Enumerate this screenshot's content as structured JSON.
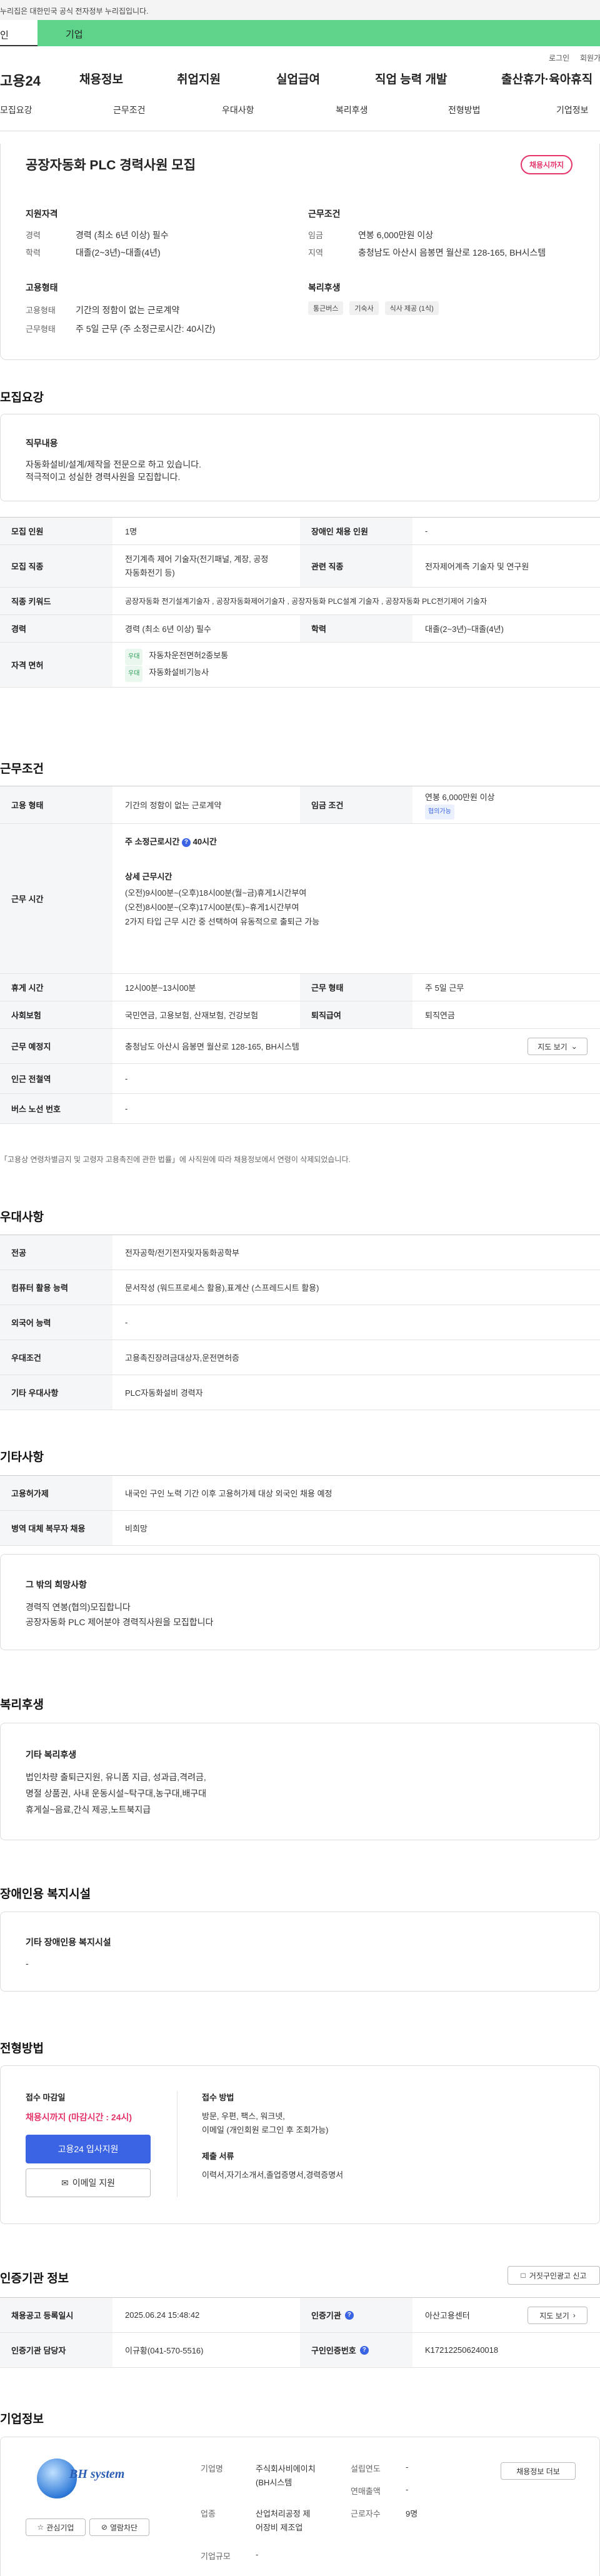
{
  "gov_bar": {
    "text": "누리집은 대한민국 공식 전자정부 누리집입니다."
  },
  "top_tabs": [
    "인",
    "기업"
  ],
  "util": {
    "login": "로그인",
    "join": "회원가"
  },
  "logo": "고용24",
  "gnb": [
    "채용정보",
    "취업지원",
    "실업급여",
    "직업 능력 개발",
    "출산휴가·육아휴직"
  ],
  "subnav": [
    "모집요강",
    "근무조건",
    "우대사항",
    "복리후생",
    "전형방법",
    "기업정보"
  ],
  "job": {
    "title": "공장자동화 PLC 경력사원 모집",
    "badge": "채용시까지",
    "qualification": {
      "head": "지원자격",
      "career_label": "경력",
      "career": "경력 (최소 6년 이상) 필수",
      "edu_label": "학력",
      "edu": "대졸(2~3년)~대졸(4년)"
    },
    "work": {
      "head": "근무조건",
      "pay_label": "임금",
      "pay": "연봉 6,000만원 이상",
      "region_label": "지역",
      "region": "충청남도 아산시 음봉면 월산로 128-165, BH시스템"
    },
    "employment": {
      "head": "고용형태",
      "type_label": "고용형태",
      "type": "기간의 정함이 없는 근로계약",
      "days_label": "근무형태",
      "days": "주 5일 근무 (주 소정근로시간: 40시간)"
    },
    "welfare": {
      "head": "복리후생",
      "chips": [
        "통근버스",
        "기숙사",
        "식사 제공 (1식)"
      ]
    }
  },
  "recruit": {
    "title": "모집요강",
    "duty_head": "직무내용",
    "duty_lines": [
      "자동화설비/설계/제작을 전문으로 하고 있습니다.",
      "적극적이고 성실한 경력사원을 모집합니다."
    ],
    "rows": {
      "headcount_label": "모집 인원",
      "headcount": "1명",
      "disabled_label": "장애인 채용 인원",
      "disabled": "-",
      "job_label": "모집 직종",
      "job_lines": [
        "전기계측 제어 기술자(전기패널, 계장, 공정",
        "자동화전기 등)"
      ],
      "related_label": "관련 직종",
      "related": "전자제어계측 기술자 및 연구원",
      "keyword_label": "직종 키워드",
      "keyword": "공장자동화 전기설계기술자 , 공장자동화제어기술자 , 공장자동화 PLC설계 기술자 , 공장자동화 PLC전기제어 기술자",
      "career_label": "경력",
      "career": "경력 (최소 6년 이상) 필수",
      "edu_label": "학력",
      "edu": "대졸(2~3년)~대졸(4년)",
      "license_label": "자격 면허",
      "licenses": [
        {
          "tag": "우대",
          "name": "자동차운전면허2종보통"
        },
        {
          "tag": "우대",
          "name": "자동화설비기능사"
        }
      ]
    }
  },
  "conditions": {
    "title": "근무조건",
    "type_label": "고용 형태",
    "type": "기간의 정함이 없는 근로계약",
    "pay_label": "임금 조건",
    "pay": "연봉 6,000만원 이상",
    "pay_tag": "협의가능",
    "hours_label": "근무 시간",
    "hours_head": "주 소정근로시간",
    "hours_value": "40시간",
    "detail_head": "상세 근무시간",
    "detail_lines": [
      "(오전)9시00분~(오후)18시00분(월~금)휴게1시간부여",
      "(오전)8시00분~(오후)17시00분(토)~휴게1시간부여",
      "2가지 타입 근무 시간 중 선택하여 유동적으로 출퇴근 가능"
    ],
    "break_label": "휴게 시간",
    "break": "12시00분~13시00분",
    "form_label": "근무 형태",
    "form": "주 5일 근무",
    "insurance_label": "사회보험",
    "insurance": "국민연금, 고용보험, 산재보험, 건강보험",
    "retire_label": "퇴직급여",
    "retire": "퇴직연금",
    "place_label": "근무 예정지",
    "place": "충청남도 아산시 음봉면 월산로 128-165, BH시스템",
    "map_btn": "지도 보기",
    "subway_label": "인근 전철역",
    "subway": "-",
    "bus_label": "버스 노선 번호",
    "bus": "-",
    "note": "「고용상 연령차별금지 및 고령자 고용촉진에 관한 법률」에 사직원에 따라 채용정보에서 연령이 삭제되었습니다."
  },
  "preference": {
    "title": "우대사항",
    "major_label": "전공",
    "major": "전자공학/전기전자및자동화공학부",
    "computer_label": "컴퓨터 활용 능력",
    "computer": "문서작성 (워드프로세스 활용),표계산 (스프레드시트 활용)",
    "lang_label": "외국어 능력",
    "lang": "-",
    "cond_label": "우대조건",
    "cond": "고용촉진장려금대상자,운전면허증",
    "etc_label": "기타 우대사항",
    "etc": "PLC자동화설비 경력자"
  },
  "other": {
    "title": "기타사항",
    "foreign_label": "고용허가제",
    "foreign": "내국인 구인 노력 기간 이후 고용허가제 대상 외국인 채용 예정",
    "military_label": "병역 대체 복무자 채용",
    "military": "비희망",
    "extra_head": "그 밖의 희망사항",
    "extra_lines": [
      "경력직 연봉(협의)모집합니다",
      "공장자동화 PLC 제어분야 경력직사원을 모집합니다"
    ]
  },
  "benefits": {
    "title": "복리후생",
    "head": "기타 복리후생",
    "lines": [
      "법인차량 출퇴근지원, 유니폼 지급, 성과급,격려금,",
      "명절 상품권, 사내 운동시설~탁구대,농구대,배구대",
      "휴게실~음료,간식 제공,노트북지급"
    ]
  },
  "disability": {
    "title": "장애인용 복지시설",
    "head": "기타 장애인용 복지시설",
    "value": "-"
  },
  "process": {
    "title": "전형방법",
    "deadline_head": "접수 마감일",
    "deadline": "채용시까지 (마감시간 : 24시)",
    "apply_btn": "고용24 입사지원",
    "email_btn": "이메일 지원",
    "method_head": "접수 방법",
    "method_lines": [
      "방문, 우편, 팩스, 워크넷,",
      "이메일 (개인회원 로그인 후 조회가능)"
    ],
    "docs_head": "제출 서류",
    "docs": "이력서,자기소개서,졸업증명서,경력증명서"
  },
  "agency": {
    "title": "인증기관 정보",
    "report_btn": "거짓구인광고 신고",
    "reg_label": "채용공고 등록일시",
    "reg": "2025.06.24 15:48:42",
    "agency_label": "인증기관",
    "agency": "아산고용센터",
    "map_btn": "지도 보기",
    "manager_label": "인증기관 담당자",
    "manager": "이규황(041-570-5516)",
    "no_label": "구인인증번호",
    "no": "K172122506240018"
  },
  "company": {
    "title": "기업정보",
    "logo_text": "BH system",
    "fav_btn": "관심기업",
    "review_btn": "열람차단",
    "name_label": "기업명",
    "name_lines": [
      "주식회사비에이치",
      "(BH시스템"
    ],
    "industry_label": "업종",
    "industry_lines": [
      "산업처리공정 제",
      "어장비 제조업"
    ],
    "size_label": "기업규모",
    "size": "-",
    "founded_label": "설립연도",
    "founded": "-",
    "sales_label": "연매출액",
    "sales": "-",
    "staff_label": "근로자수",
    "staff": "9명",
    "more_btn": "채용정보 더보",
    "colors": {
      "accent": "#e5356a",
      "primary": "#3b64e4",
      "green": "#5dd48a"
    }
  }
}
